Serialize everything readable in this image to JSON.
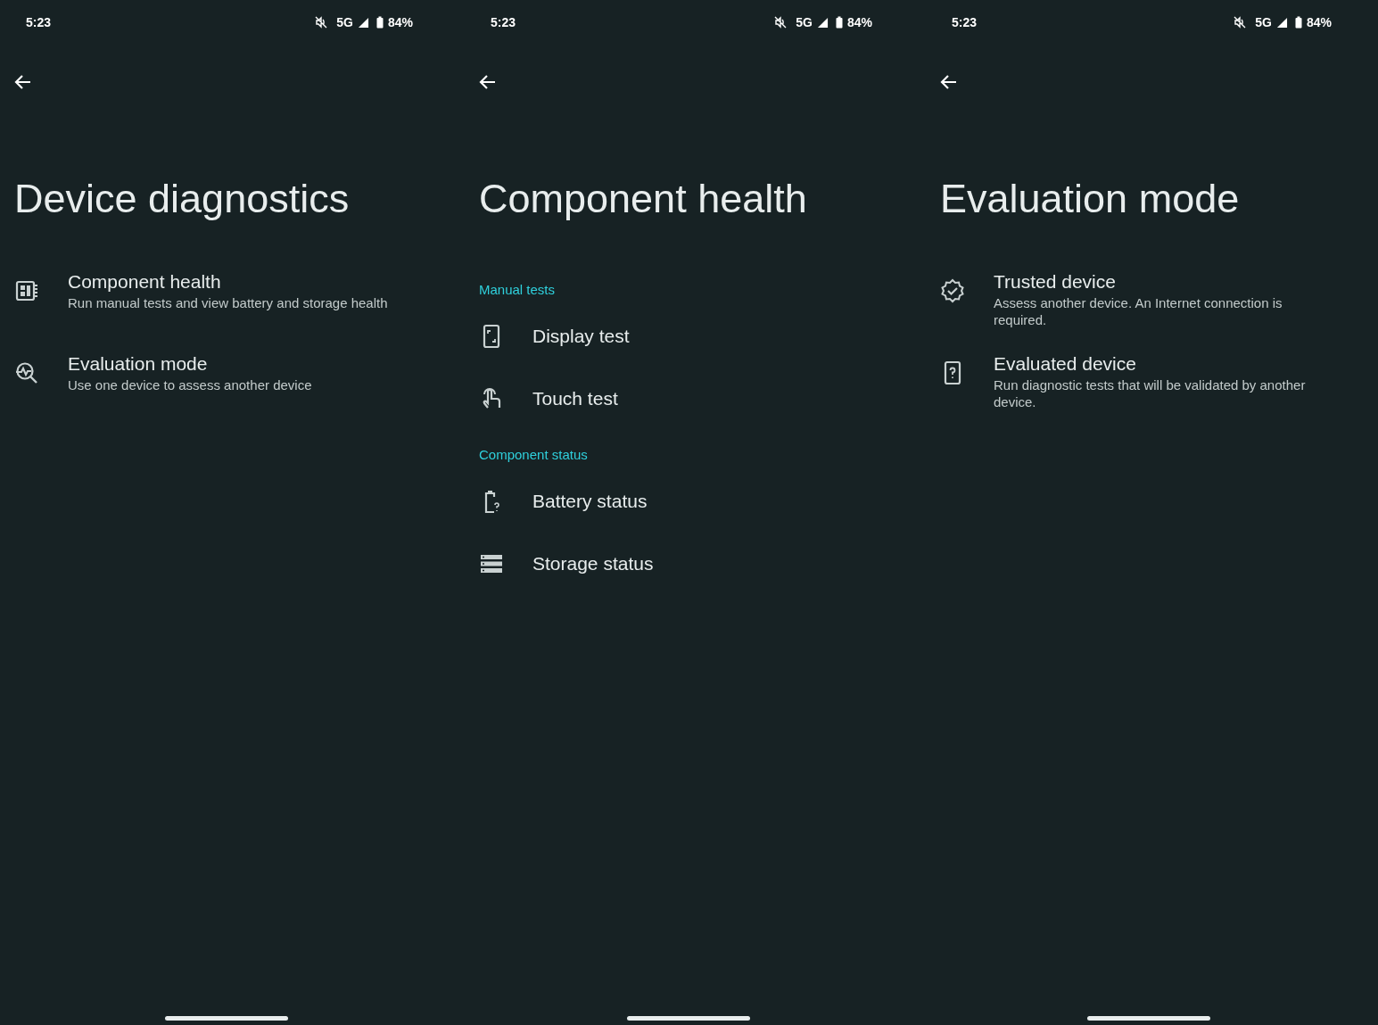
{
  "screens": [
    {
      "status_bar": {
        "time": "5:23",
        "network": "5G",
        "battery": "84%"
      },
      "title": "Device diagnostics",
      "items": [
        {
          "kind": "entry",
          "title": "Component health",
          "subtitle": "Run manual tests and view battery and storage health"
        },
        {
          "kind": "entry",
          "title": "Evaluation mode",
          "subtitle": "Use one device to assess another device"
        }
      ]
    },
    {
      "status_bar": {
        "time": "5:23",
        "network": "5G",
        "battery": "84%"
      },
      "title": "Component health",
      "items": [
        {
          "kind": "header",
          "title": "Manual tests"
        },
        {
          "kind": "entry",
          "title": "Display test"
        },
        {
          "kind": "entry",
          "title": "Touch test"
        },
        {
          "kind": "header",
          "title": "Component status"
        },
        {
          "kind": "entry",
          "title": "Battery status"
        },
        {
          "kind": "entry",
          "title": "Storage status"
        }
      ]
    },
    {
      "status_bar": {
        "time": "5:23",
        "network": "5G",
        "battery": "84%"
      },
      "title": "Evaluation mode",
      "items": [
        {
          "kind": "entry",
          "title": "Trusted device",
          "subtitle": "Assess another device. An Internet connection is required."
        },
        {
          "kind": "entry",
          "title": "Evaluated device",
          "subtitle": "Run diagnostic tests that will be validated by another device."
        }
      ]
    }
  ]
}
